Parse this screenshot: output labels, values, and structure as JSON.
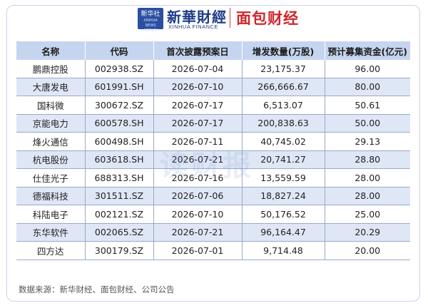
{
  "header": {
    "xinhua_badge": "新华社",
    "xinhua_badge_sub": "XINHUA NEWS AGENCY",
    "xinhua_name": "新華財經",
    "xinhua_en": "XINHUA FINANCE",
    "mianbao_name": "面包财经"
  },
  "watermark": "读财报",
  "table": {
    "headers": [
      "名称",
      "代码",
      "首次披露预案日",
      "增发数量(万股)",
      "预计募集资金(亿元)"
    ],
    "rows": [
      [
        "鹏鼎控股",
        "002938.SZ",
        "2026-07-04",
        "23,175.37",
        "96.00"
      ],
      [
        "大唐发电",
        "601991.SH",
        "2026-07-10",
        "266,666.67",
        "80.00"
      ],
      [
        "国科微",
        "300672.SZ",
        "2026-07-17",
        "6,513.07",
        "50.61"
      ],
      [
        "京能电力",
        "600578.SH",
        "2026-07-17",
        "200,838.63",
        "50.00"
      ],
      [
        "烽火通信",
        "600498.SH",
        "2026-07-11",
        "40,745.02",
        "29.13"
      ],
      [
        "杭电股份",
        "603618.SH",
        "2026-07-21",
        "20,741.27",
        "28.80"
      ],
      [
        "仕佳光子",
        "688313.SH",
        "2026-07-16",
        "13,559.59",
        "28.00"
      ],
      [
        "德福科技",
        "301511.SZ",
        "2026-07-06",
        "18,827.24",
        "28.00"
      ],
      [
        "科陆电子",
        "002121.SZ",
        "2026-07-10",
        "50,176.52",
        "25.00"
      ],
      [
        "东华软件",
        "002065.SZ",
        "2026-07-21",
        "96,164.47",
        "20.29"
      ],
      [
        "四方达",
        "300179.SZ",
        "2026-07-01",
        "9,714.48",
        "20.00"
      ]
    ]
  },
  "source": "数据来源：新华财经、面包财经、公司公告"
}
